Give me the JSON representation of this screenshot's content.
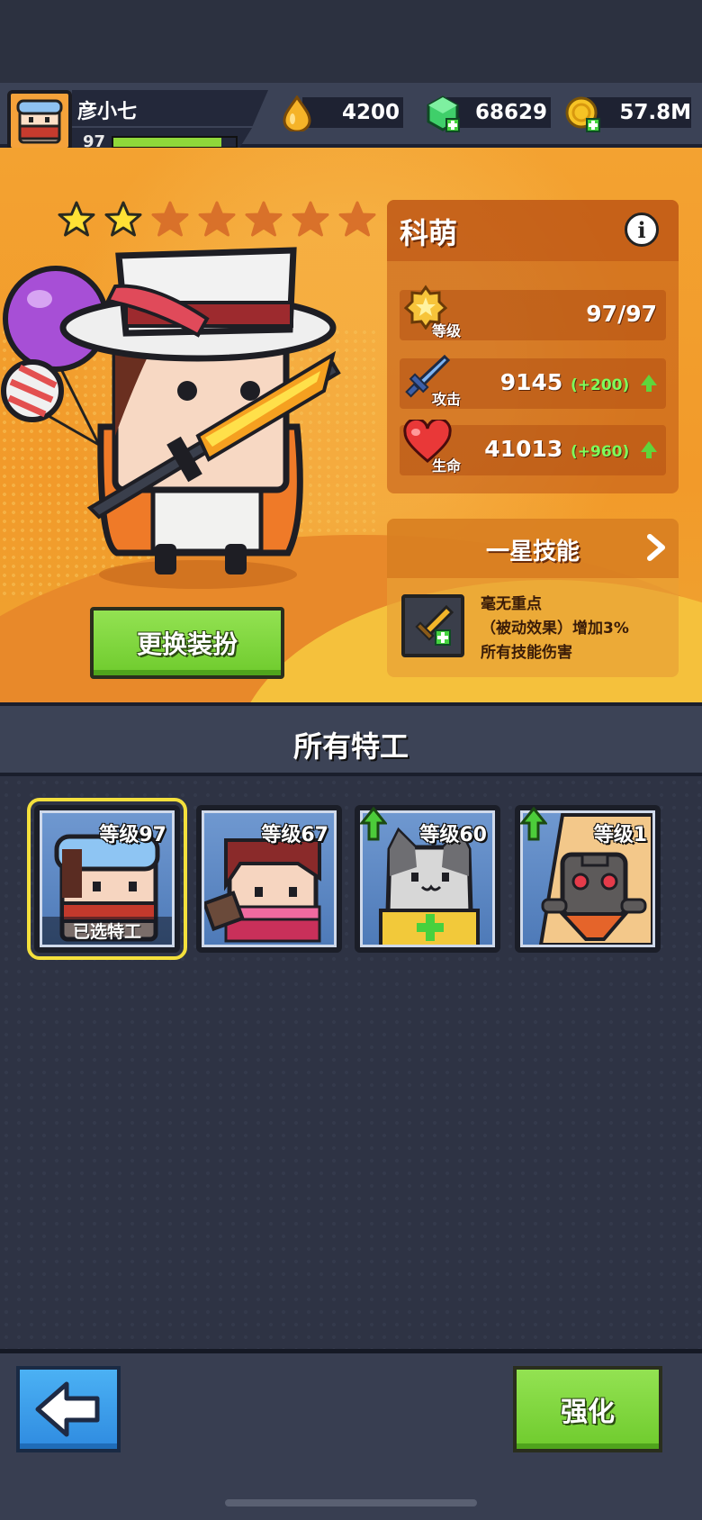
{
  "player": {
    "name": "彦小七",
    "level": "97",
    "xp_progress": 0.88
  },
  "resources": {
    "energy": "4200",
    "gems": "68629",
    "coins": "57.8M"
  },
  "hero": {
    "name": "科萌",
    "stars_filled": 2,
    "stars_total": 7,
    "outfit_button": "更换装扮",
    "stats": {
      "level": {
        "label": "等级",
        "value": "97/97"
      },
      "attack": {
        "label": "攻击",
        "value": "9145",
        "bonus": "(+200)"
      },
      "health": {
        "label": "生命",
        "value": "41013",
        "bonus": "(+960)"
      }
    },
    "skill": {
      "title": "一星技能",
      "name": "毫无重点",
      "line2": "（被动效果）增加3%",
      "line3": "所有技能伤害"
    }
  },
  "agents_section": {
    "title": "所有特工",
    "agents": [
      {
        "level_label": "等级97",
        "tag": "已选特工",
        "selected": true,
        "upgrade": false
      },
      {
        "level_label": "等级67",
        "tag": "",
        "selected": false,
        "upgrade": false
      },
      {
        "level_label": "等级60",
        "tag": "",
        "selected": false,
        "upgrade": true
      },
      {
        "level_label": "等级1",
        "tag": "",
        "selected": false,
        "upgrade": true
      }
    ]
  },
  "bottom": {
    "enhance_label": "强化"
  },
  "colors": {
    "panel_orange": "#f29a2a",
    "button_green": "#7fd83e",
    "button_blue": "#3a9eec",
    "selected_outline": "#f4e03c",
    "bonus_green": "#7dff5c"
  },
  "icons": [
    "energy-drop-icon",
    "gem-icon",
    "coin-icon",
    "star-icon",
    "info-icon",
    "level-badge-icon",
    "sword-icon",
    "heart-icon",
    "chevron-right-icon",
    "skill-sword-icon",
    "back-arrow-icon",
    "upgrade-arrow-icon"
  ]
}
